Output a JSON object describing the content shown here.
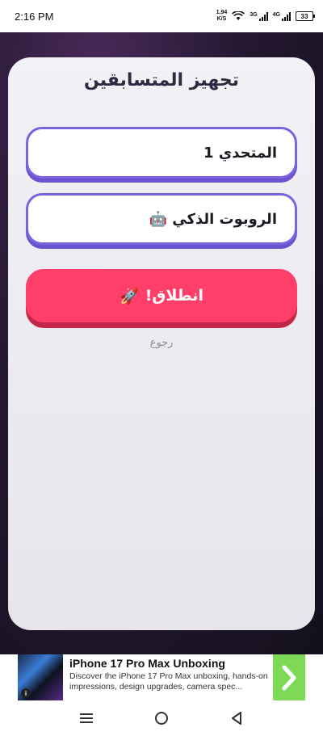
{
  "status_bar": {
    "time": "2:16 PM",
    "net_speed_value": "1.94",
    "net_speed_unit": "K/S",
    "sim1_label": "3G",
    "sim2_label": "4G",
    "battery": "33"
  },
  "setup": {
    "title": "تجهيز المتسابقين",
    "player1_value": "المتحدي 1",
    "player2_value": "الروبوت الذكي 🤖",
    "start_label": "انطلاق!",
    "start_icon": "🚀",
    "back_label": "رجوع"
  },
  "ad": {
    "title": "iPhone 17 Pro Max Unboxing",
    "description": "Discover the iPhone 17 Pro Max unboxing, hands-on impressions, design upgrades, camera spec...",
    "info_icon": "i"
  },
  "colors": {
    "accent_purple": "#7b63e0",
    "start_button": "#ff3f6a",
    "ad_cta": "#7ed957"
  }
}
